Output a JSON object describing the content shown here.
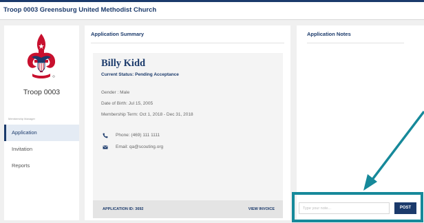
{
  "header": {
    "title": "Troop 0003 Greensburg United Methodist Church"
  },
  "sidebar": {
    "troop_name": "Troop 0003",
    "section_label": "Membership Manager",
    "items": [
      {
        "label": "Application",
        "active": true
      },
      {
        "label": "Invitation",
        "active": false
      },
      {
        "label": "Reports",
        "active": false
      }
    ]
  },
  "summary": {
    "title": "Application Summary",
    "name": "Billy Kidd",
    "status": "Current Status:  Pending Acceptance",
    "gender": "Gender : Male",
    "dob": "Date of Birth: Jul 15, 2005",
    "term": "Membership Term: Oct 1, 2018 - Dec 31, 2018",
    "phone": "Phone:  (469) 111 1111",
    "email": "Email:  qa@scouting.org",
    "application_id": "APPLICATION ID: 3692",
    "view_invoice": "VIEW INVOICE",
    "icons": {
      "phone": "phone-icon",
      "email": "envelope-icon"
    }
  },
  "notes": {
    "title": "Application Notes",
    "input_placeholder": "Type your note...",
    "input_value": "",
    "post_label": "POST"
  },
  "colors": {
    "brand_navy": "#1b3a6b",
    "callout_teal": "#16899a",
    "logo_red": "#c8102e",
    "background": "#f0f0f0"
  }
}
